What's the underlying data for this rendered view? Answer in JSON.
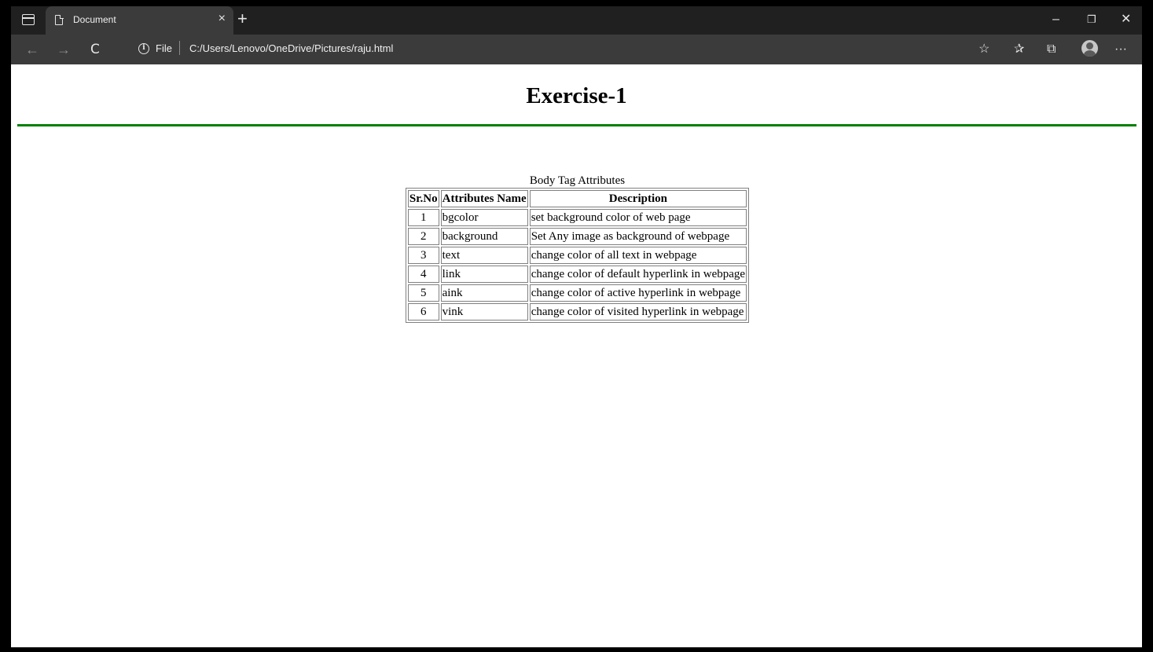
{
  "browser": {
    "tab_title": "Document",
    "new_tab_label": "+",
    "close_tab_label": "×",
    "site_info_label": "File",
    "url": "C:/Users/Lenovo/OneDrive/Pictures/raju.html",
    "window_controls": {
      "minimize": "–",
      "restore": "❐",
      "close": "✕"
    },
    "nav": {
      "back": "←",
      "forward": "→",
      "refresh": "C"
    },
    "toolbar_icons": [
      "add-favorite-icon",
      "favorites-icon",
      "collections-icon",
      "profile-icon",
      "more-icon"
    ],
    "more_label": "···"
  },
  "page": {
    "heading": "Exercise-1",
    "rule_color": "#008000",
    "table": {
      "caption": "Body Tag Attributes",
      "headers": [
        "Sr.No",
        "Attributes Name",
        "Description"
      ],
      "rows": [
        [
          "1",
          "bgcolor",
          "set background color of web page"
        ],
        [
          "2",
          "background",
          "Set Any image as background of webpage"
        ],
        [
          "3",
          "text",
          "change color of all text in webpage"
        ],
        [
          "4",
          "link",
          "change color of default hyperlink in webpage"
        ],
        [
          "5",
          "aink",
          "change color of active hyperlink in webpage"
        ],
        [
          "6",
          "vink",
          "change color of visited hyperlink in webpage"
        ]
      ]
    }
  }
}
